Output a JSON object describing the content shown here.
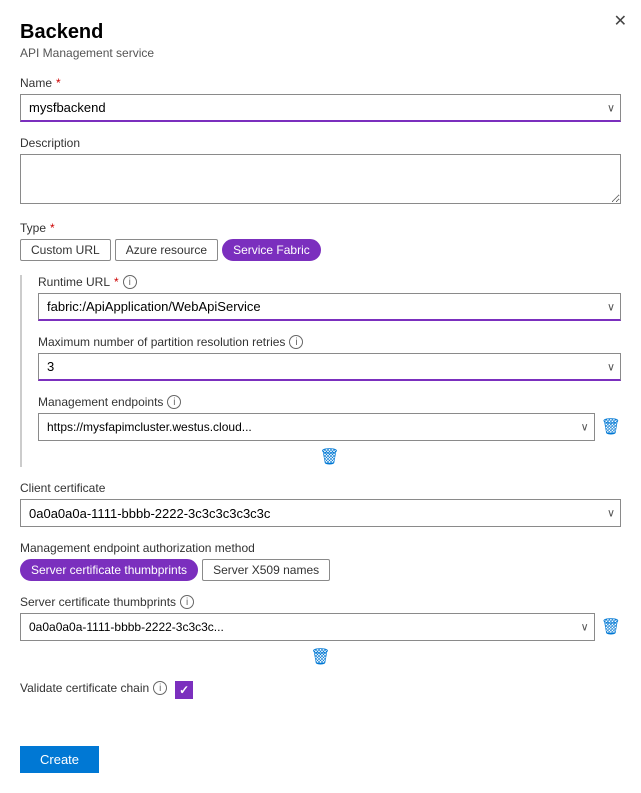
{
  "panel": {
    "title": "Backend",
    "subtitle": "API Management service"
  },
  "fields": {
    "name_label": "Name",
    "name_value": "mysfbackend",
    "description_label": "Description",
    "description_placeholder": "",
    "type_label": "Type",
    "type_options": [
      {
        "label": "Custom URL",
        "active": false
      },
      {
        "label": "Azure resource",
        "active": false
      },
      {
        "label": "Service Fabric",
        "active": true
      }
    ],
    "runtime_url_label": "Runtime URL",
    "runtime_url_value": "fabric:/ApiApplication/WebApiService",
    "max_retries_label": "Maximum number of partition resolution retries",
    "max_retries_value": "3",
    "management_endpoints_label": "Management endpoints",
    "management_endpoint_value": "https://mysfapimcluster.westus.cloud...",
    "client_cert_label": "Client certificate",
    "client_cert_value": "0a0a0a0a-1111-bbbb-2222-3c3c3c3c3c3c",
    "auth_method_label": "Management endpoint authorization method",
    "auth_options": [
      {
        "label": "Server certificate thumbprints",
        "active": true
      },
      {
        "label": "Server X509 names",
        "active": false
      }
    ],
    "thumbprints_label": "Server certificate thumbprints",
    "thumbprint_value": "0a0a0a0a-1111-bbbb-2222-3c3c3c...",
    "validate_label": "Validate certificate chain"
  },
  "buttons": {
    "create_label": "Create",
    "close_label": "✕",
    "add_icon": "⊕",
    "delete_icon": "🗑",
    "info_icon": "i",
    "chevron": "∨"
  },
  "colors": {
    "accent": "#7b2fbe",
    "primary_btn": "#0078d4"
  }
}
